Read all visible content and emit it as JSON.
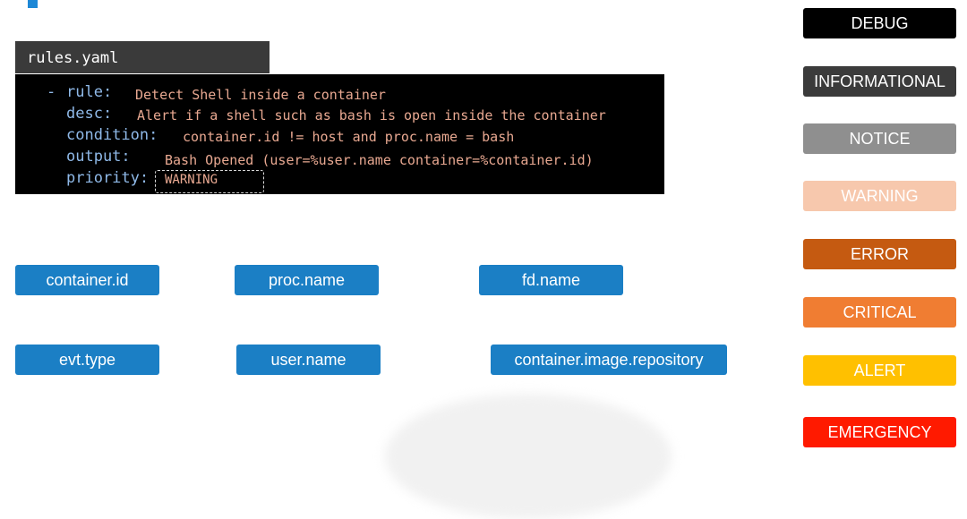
{
  "file_tab": {
    "label": "rules.yaml"
  },
  "rule": {
    "dash": "-",
    "rule_key": "rule:",
    "rule_value": "Detect Shell inside a container",
    "desc_key": "desc:",
    "desc_value": "Alert if a shell such as bash is open inside the container",
    "condition_key": "condition:",
    "condition_value": "container.id != host and proc.name = bash",
    "output_key": "output:",
    "output_value": "Bash Opened (user=%user.name container=%container.id)",
    "priority_key": "priority:",
    "priority_value": "WARNING"
  },
  "fields": [
    "container.id",
    "proc.name",
    "fd.name",
    "evt.type",
    "user.name",
    "container.image.repository"
  ],
  "priority_levels": [
    {
      "label": "DEBUG",
      "color": "#000000"
    },
    {
      "label": "INFORMATIONAL",
      "color": "#3b3b3b"
    },
    {
      "label": "NOTICE",
      "color": "#8f8f8f"
    },
    {
      "label": "WARNING",
      "color": "#f7c8ad"
    },
    {
      "label": "ERROR",
      "color": "#c55a11"
    },
    {
      "label": "CRITICAL",
      "color": "#f07d32"
    },
    {
      "label": "ALERT",
      "color": "#ffc000"
    },
    {
      "label": "EMERGENCY",
      "color": "#ff1a00"
    }
  ]
}
